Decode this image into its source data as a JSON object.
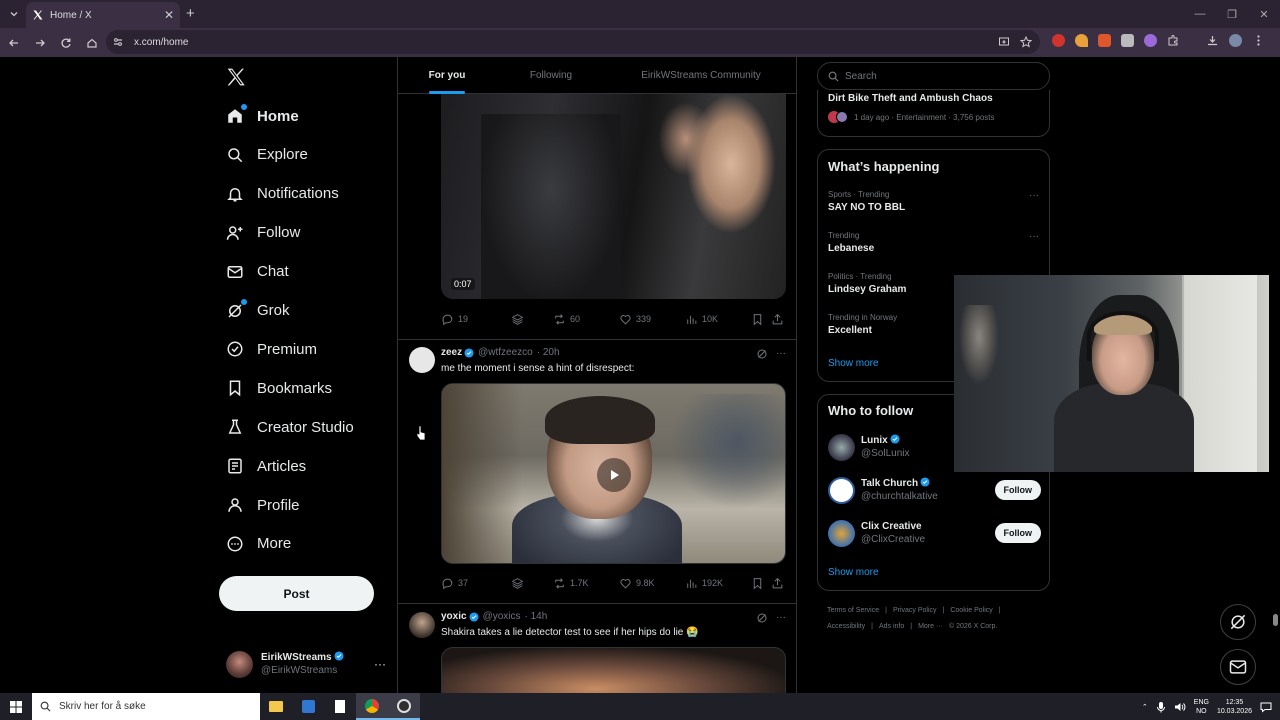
{
  "browser": {
    "tab_title": "Home / X",
    "url": "x.com/home"
  },
  "nav": {
    "items": [
      {
        "label": "Home",
        "icon": "home-icon",
        "active": true,
        "dot": true
      },
      {
        "label": "Explore",
        "icon": "search-icon"
      },
      {
        "label": "Notifications",
        "icon": "bell-icon"
      },
      {
        "label": "Follow",
        "icon": "person-add-icon"
      },
      {
        "label": "Chat",
        "icon": "envelope-icon"
      },
      {
        "label": "Grok",
        "icon": "grok-icon",
        "dot": true
      },
      {
        "label": "Premium",
        "icon": "premium-icon"
      },
      {
        "label": "Bookmarks",
        "icon": "bookmark-icon"
      },
      {
        "label": "Creator Studio",
        "icon": "flask-icon"
      },
      {
        "label": "Articles",
        "icon": "articles-icon"
      },
      {
        "label": "Profile",
        "icon": "profile-icon"
      },
      {
        "label": "More",
        "icon": "more-circle-icon"
      }
    ],
    "post_label": "Post",
    "account": {
      "name": "EirikWStreams",
      "handle": "@EirikWStreams",
      "more": "···"
    }
  },
  "feed": {
    "tabs": [
      "For you",
      "Following",
      "EirikWStreams Community"
    ],
    "post1": {
      "video_time": "0:07",
      "replies": "19",
      "reposts": "60",
      "likes": "339",
      "views": "10K"
    },
    "post2": {
      "name": "zeez",
      "handle": "@wtfzeezco",
      "time": "· 20h",
      "text": "me the moment i sense a hint of disrespect:",
      "replies": "37",
      "reposts": "1.7K",
      "likes": "9.8K",
      "views": "192K"
    },
    "post3": {
      "name": "yoxic",
      "handle": "@yoxics",
      "time": "· 14h",
      "text": "Shakira takes a lie detector test to see if her hips do lie 😭"
    }
  },
  "right": {
    "search_placeholder": "Search",
    "top_story": {
      "title": "Dirt Bike Theft and Ambush Chaos",
      "meta": "1 day ago · Entertainment · 3,756 posts"
    },
    "happening": {
      "title": "What’s happening",
      "trends": [
        {
          "context": "Sports · Trending",
          "name": "SAY NO TO BBL"
        },
        {
          "context": "Trending",
          "name": "Lebanese"
        },
        {
          "context": "Politics · Trending",
          "name": "Lindsey Graham"
        },
        {
          "context": "Trending in Norway",
          "name": "Excellent"
        }
      ],
      "show_more": "Show more"
    },
    "who_to_follow": {
      "title": "Who to follow",
      "accounts": [
        {
          "name": "Lunix",
          "handle": "@SolLunix"
        },
        {
          "name": "Talk Church",
          "handle": "@churchtalkative",
          "button": "Follow"
        },
        {
          "name": "Clix Creative",
          "handle": "@ClixCreative",
          "button": "Follow"
        }
      ],
      "show_more": "Show more"
    },
    "footer": [
      "Terms of Service",
      "|",
      "Privacy Policy",
      "|",
      "Cookie Policy",
      "|",
      "Accessibility",
      "|",
      "Ads info",
      "|",
      "More ···",
      "© 2026 X Corp."
    ]
  },
  "taskbar": {
    "search_placeholder": "Skriv her for å søke",
    "lang_top": "ENG",
    "lang_bottom": "NO",
    "time": "12:35",
    "date": "10.03.2026"
  },
  "colors": {
    "accent": "#1d9bf0",
    "background": "#000000",
    "chrome": "#3b2f43"
  }
}
